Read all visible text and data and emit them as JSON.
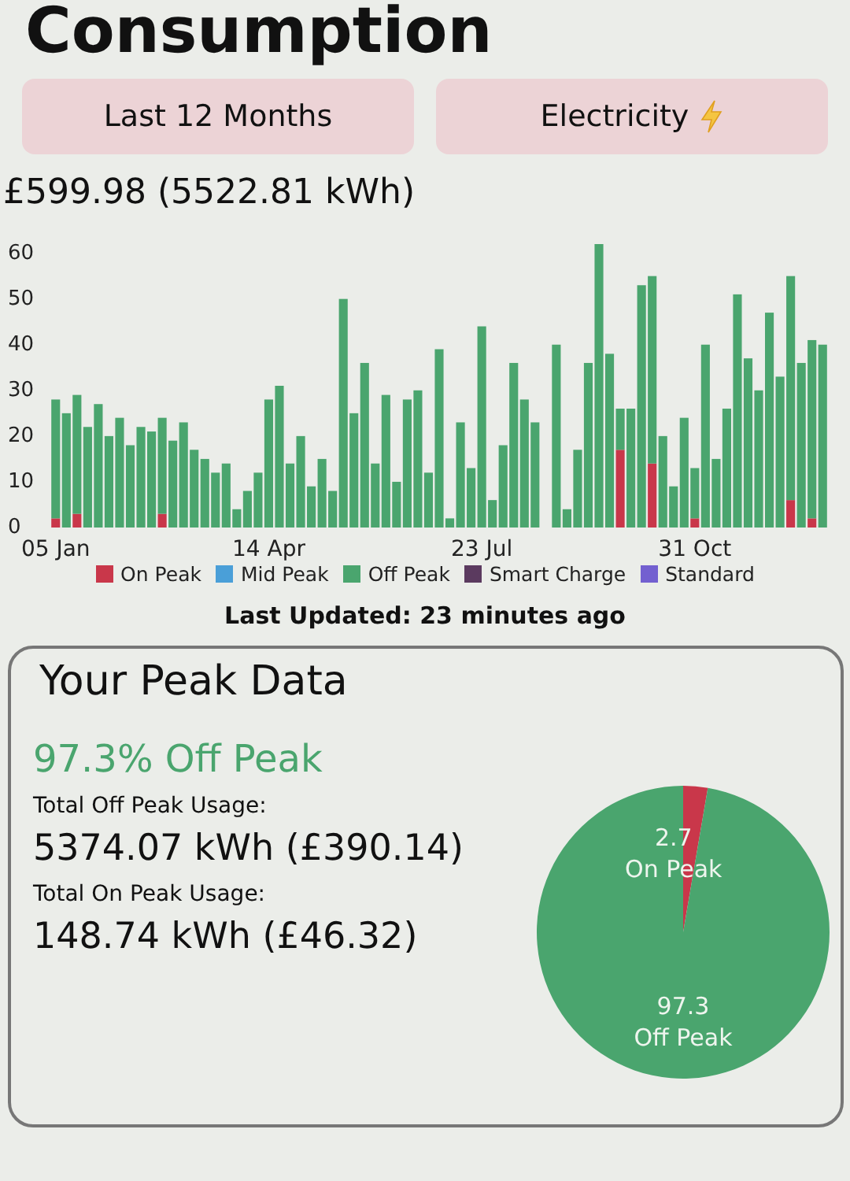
{
  "title": "Consumption",
  "filters": [
    {
      "label": "Last 12 Months",
      "kind": "period"
    },
    {
      "label": "Electricity",
      "kind": "fuel"
    }
  ],
  "total": "£599.98 (5522.81 kWh)",
  "usage_chart": {
    "chart_data": {
      "type": "bar",
      "stacked": true,
      "ylim": [
        0,
        62
      ],
      "yticks": [
        {
          "value": 0,
          "label": "0"
        },
        {
          "value": 10,
          "label": "10"
        },
        {
          "value": 20,
          "label": "20"
        },
        {
          "value": 30,
          "label": "30"
        },
        {
          "value": 40,
          "label": "40"
        },
        {
          "value": 50,
          "label": "50"
        },
        {
          "value": 60,
          "label": "60"
        }
      ],
      "categories": [
        "05 Jan",
        null,
        null,
        null,
        null,
        null,
        null,
        null,
        null,
        null,
        null,
        null,
        null,
        null,
        null,
        null,
        null,
        null,
        null,
        null,
        "14 Apr",
        null,
        null,
        null,
        null,
        null,
        null,
        null,
        null,
        null,
        null,
        null,
        null,
        null,
        null,
        null,
        null,
        null,
        null,
        null,
        "23 Jul",
        null,
        null,
        null,
        null,
        null,
        null,
        null,
        null,
        null,
        null,
        null,
        null,
        null,
        null,
        null,
        null,
        null,
        null,
        null,
        "31 Oct",
        null,
        null,
        null,
        null,
        null,
        null,
        null,
        null,
        null,
        null,
        null,
        null
      ],
      "series": [
        {
          "name": "On Peak",
          "color": "#c9374a",
          "values": [
            2,
            0,
            3,
            0,
            0,
            0,
            0,
            0,
            0,
            0,
            3,
            0,
            0,
            0,
            0,
            0,
            0,
            0,
            0,
            0,
            0,
            0,
            0,
            0,
            0,
            0,
            0,
            0,
            0,
            0,
            0,
            0,
            0,
            0,
            0,
            0,
            0,
            0,
            0,
            0,
            0,
            0,
            0,
            0,
            0,
            0,
            0,
            0,
            0,
            0,
            0,
            0,
            0,
            17,
            0,
            0,
            14,
            0,
            0,
            0,
            2,
            0,
            0,
            0,
            0,
            0,
            0,
            0,
            0,
            6,
            0,
            2,
            0
          ]
        },
        {
          "name": "Mid Peak",
          "color": "#4a9fd8",
          "values": [
            0,
            0,
            0,
            0,
            0,
            0,
            0,
            0,
            0,
            0,
            0,
            0,
            0,
            0,
            0,
            0,
            0,
            0,
            0,
            0,
            0,
            0,
            0,
            0,
            0,
            0,
            0,
            0,
            0,
            0,
            0,
            0,
            0,
            0,
            0,
            0,
            0,
            0,
            0,
            0,
            0,
            0,
            0,
            0,
            0,
            0,
            0,
            0,
            0,
            0,
            0,
            0,
            0,
            0,
            0,
            0,
            0,
            0,
            0,
            0,
            0,
            0,
            0,
            0,
            0,
            0,
            0,
            0,
            0,
            0,
            0,
            0,
            0
          ]
        },
        {
          "name": "Off Peak",
          "color": "#4aa56e",
          "values": [
            26,
            25,
            26,
            22,
            27,
            20,
            24,
            18,
            22,
            21,
            21,
            19,
            23,
            17,
            15,
            12,
            14,
            4,
            8,
            12,
            28,
            31,
            14,
            20,
            9,
            15,
            8,
            50,
            25,
            36,
            14,
            29,
            10,
            28,
            30,
            12,
            39,
            2,
            23,
            13,
            44,
            6,
            18,
            36,
            28,
            23,
            0,
            40,
            4,
            17,
            36,
            62,
            38,
            9,
            26,
            53,
            41,
            20,
            9,
            24,
            11,
            40,
            15,
            26,
            51,
            37,
            30,
            47,
            33,
            49,
            36,
            39,
            40
          ]
        },
        {
          "name": "Smart Charge",
          "color": "#5b3a5f",
          "values": [
            0,
            0,
            0,
            0,
            0,
            0,
            0,
            0,
            0,
            0,
            0,
            0,
            0,
            0,
            0,
            0,
            0,
            0,
            0,
            0,
            0,
            0,
            0,
            0,
            0,
            0,
            0,
            0,
            0,
            0,
            0,
            0,
            0,
            0,
            0,
            0,
            0,
            0,
            0,
            0,
            0,
            0,
            0,
            0,
            0,
            0,
            0,
            0,
            0,
            0,
            0,
            0,
            0,
            0,
            0,
            0,
            0,
            0,
            0,
            0,
            0,
            0,
            0,
            0,
            0,
            0,
            0,
            0,
            0,
            0,
            0,
            0,
            0
          ]
        },
        {
          "name": "Standard",
          "color": "#7360d0",
          "values": [
            0,
            0,
            0,
            0,
            0,
            0,
            0,
            0,
            0,
            0,
            0,
            0,
            0,
            0,
            0,
            0,
            0,
            0,
            0,
            0,
            0,
            0,
            0,
            0,
            0,
            0,
            0,
            0,
            0,
            0,
            0,
            0,
            0,
            0,
            0,
            0,
            0,
            0,
            0,
            0,
            0,
            0,
            0,
            0,
            0,
            0,
            0,
            0,
            0,
            0,
            0,
            0,
            0,
            0,
            0,
            0,
            0,
            0,
            0,
            0,
            0,
            0,
            0,
            0,
            0,
            0,
            0,
            0,
            0,
            0,
            0,
            0,
            0
          ]
        }
      ]
    }
  },
  "last_updated": "Last Updated: 23 minutes ago",
  "peak_card": {
    "title": "Your Peak Data",
    "headline": "97.3% Off Peak",
    "stats": [
      {
        "label": "Total Off Peak Usage:",
        "value": "5374.07 kWh (£390.14)"
      },
      {
        "label": "Total On Peak Usage:",
        "value": "148.74 kWh (£46.32)"
      }
    ],
    "chart_data": {
      "type": "pie",
      "categories": [
        "On Peak",
        "Off Peak"
      ],
      "values": [
        2.7,
        97.3
      ],
      "colors": [
        "#c9374a",
        "#4aa56e"
      ],
      "data_labels": true
    }
  }
}
